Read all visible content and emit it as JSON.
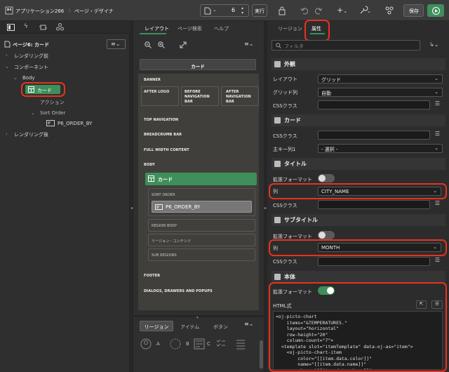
{
  "header": {
    "app_title": "アプリケーション266",
    "separator": "\\",
    "page_designer": "ページ・デザイナ",
    "page_number": "6",
    "run_label": "実行",
    "save_label": "保存"
  },
  "left": {
    "page_title": "ページ6: カード",
    "tree": {
      "pre_render": "レンダリング前",
      "components": "コンポーネント",
      "body": "Body",
      "card": "カード",
      "action": "アクション",
      "sort_order": "Sort Order",
      "order_by": "P6_ORDER_BY",
      "post_render": "レンダリング後"
    }
  },
  "mid": {
    "tabs": [
      "レイアウト",
      "ページ検索",
      "ヘルプ"
    ],
    "card_button": "カード",
    "regions": {
      "banner": "BANNER",
      "after_logo": "AFTER LOGO",
      "before_nav": "BEFORE NAVIGATION BAR",
      "after_nav": "AFTER NAVIGATION BAR",
      "top_nav": "TOP NAVIGATION",
      "breadcrumb": "BREADCRUMB BAR",
      "full_width": "FULL WIDTH CONTENT",
      "body": "BODY",
      "card": "カード",
      "sort_order": "SORT ORDER",
      "order_by": "P6_ORDER_BY",
      "region_body": "REGION BODY",
      "region_content": "リージョン・コンテンツ",
      "sub_regions": "SUB REGIONS",
      "footer": "FOOTER",
      "dialogs": "DIALOGS, DRAWERS AND POPUPS"
    },
    "bottom_tabs": [
      "リージョン",
      "アイテム",
      "ボタン"
    ],
    "gallery": [
      "A",
      "B",
      "C"
    ]
  },
  "right": {
    "tabs": [
      "リージョン",
      "属性"
    ],
    "filter_placeholder": "フィルタ",
    "appearance": {
      "title": "外観",
      "layout_label": "レイアウト",
      "layout_value": "グリッド",
      "grid_label": "グリッド列",
      "grid_value": "自動",
      "css_label": "CSSクラス"
    },
    "card": {
      "title": "カード",
      "css_label": "CSSクラス",
      "pk_label": "主キー列1",
      "pk_value": "- 選択 -"
    },
    "title_sec": {
      "title": "タイトル",
      "adv_label": "拡張フォーマット",
      "col_label": "列",
      "col_value": "CITY_NAME",
      "css_label": "CSSクラス"
    },
    "subtitle_sec": {
      "title": "サブタイトル",
      "adv_label": "拡張フォーマット",
      "col_label": "列",
      "col_value": "MONTH",
      "css_label": "CSSクラス"
    },
    "body_sec": {
      "title": "本体",
      "adv_label": "拡張フォーマット",
      "html_label": "HTML式",
      "code": [
        "<oj-picto-chart",
        "    items=\"&TEMPERATURES.\"",
        "    layout=\"horizontal\"",
        "    row-height=\"20\"",
        "    column-count=\"7\">",
        "  <template slot=\"itemTemplate\" data-oj-as=\"item\">",
        "    <oj-picto-chart-item",
        "        color=\"[[item.data.color]]\"",
        "        name=\"[[item.data.name]]\"",
        "        shape=\"[[item.data.shape]]\">"
      ]
    }
  },
  "colors": {
    "accent": "#3f8f5a",
    "highlight": "#e8321e",
    "run": "#3f8f5a"
  }
}
